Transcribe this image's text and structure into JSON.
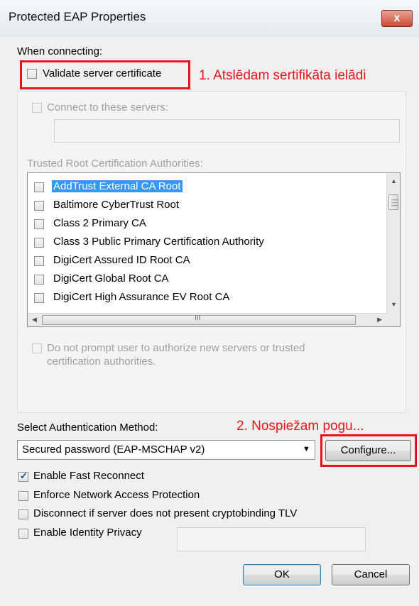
{
  "window": {
    "title": "Protected EAP Properties",
    "close_glyph": "x"
  },
  "connecting": {
    "heading": "When connecting:",
    "validate_label": "Validate server certificate",
    "connect_label": "Connect to these servers:",
    "trusted_heading": "Trusted Root Certification Authorities:",
    "authorities": [
      "AddTrust External CA Root",
      "Baltimore CyberTrust Root",
      "Class 2 Primary CA",
      "Class 3 Public Primary Certification Authority",
      "DigiCert Assured ID Root CA",
      "DigiCert Global Root CA",
      "DigiCert High Assurance EV Root CA"
    ],
    "scroll_grip": "III",
    "no_prompt_line1": "Do not prompt user to authorize new servers or trusted",
    "no_prompt_line2": "certification authorities."
  },
  "auth": {
    "heading": "Select Authentication Method:",
    "selected": "Secured password (EAP-MSCHAP v2)",
    "configure_label": "Configure..."
  },
  "options": {
    "fast_reconnect": "Enable Fast Reconnect",
    "enforce_nap": "Enforce Network Access Protection",
    "disconnect_tlv": "Disconnect if server does not present cryptobinding TLV",
    "identity_privacy": "Enable Identity Privacy"
  },
  "buttons": {
    "ok": "OK",
    "cancel": "Cancel"
  },
  "annotations": {
    "step1": "1. Atslēdam sertifikāta ielādi",
    "step2": "2. Nospiežam pogu..."
  },
  "colors": {
    "annotation_red": "#e8141b",
    "selection_blue": "#3399ff"
  }
}
